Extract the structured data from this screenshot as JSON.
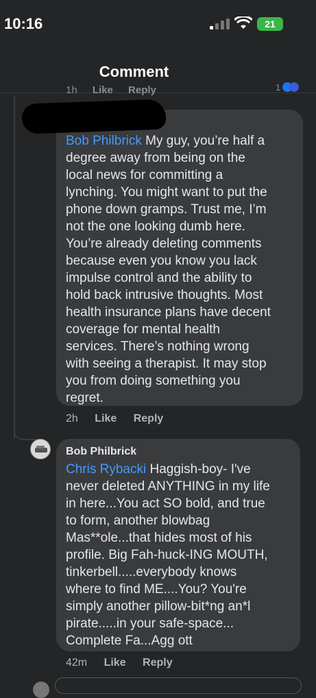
{
  "status": {
    "time": "10:16",
    "battery": "21"
  },
  "header": {
    "title": "Comment"
  },
  "partial_meta": {
    "time": "1h",
    "like": "Like",
    "reply": "Reply",
    "count": "1"
  },
  "comment1": {
    "mention": "Bob Philbrick",
    "lines": [
      " My guy, you’re half a",
      "degree away from being on the",
      "local news for committing a",
      "lynching. You might want to put the",
      "phone down gramps. Trust me, I’m",
      "not the one looking dumb here.",
      "You’re already deleting comments",
      "because even you know you lack",
      "impulse control and the ability to",
      "hold back intrusive thoughts. Most",
      "health insurance plans have decent",
      "coverage for mental health",
      "services. There’s nothing wrong",
      "with seeing a therapist. It may stop",
      "you from doing something you",
      "regret."
    ],
    "time": "2h",
    "like": "Like",
    "reply": "Reply"
  },
  "comment2": {
    "author": "Bob Philbrick",
    "mention": "Chris Rybacki",
    "lines": [
      "  Haggish-boy- I've",
      "never deleted ANYTHING in my life",
      "in here...You act SO bold, and true",
      "to form, another blowbag",
      "Mas**ole...that hides most of his",
      "profile. Big Fah-huck-ING MOUTH,",
      "tinkerbell.....everybody knows",
      "where to find ME....You? You're",
      "simply another pillow-bit*ng an*l",
      "pirate.....in your safe-space...",
      "Complete Fa...Agg  ott"
    ],
    "time": "42m",
    "like": "Like",
    "reply": "Reply"
  },
  "colors": {
    "background": "#242526",
    "bubble": "#3a3b3c",
    "mention": "#4599ff",
    "meta": "#b0b3b8"
  },
  "icons": [
    "signal-icon",
    "wifi-icon",
    "battery-icon"
  ]
}
